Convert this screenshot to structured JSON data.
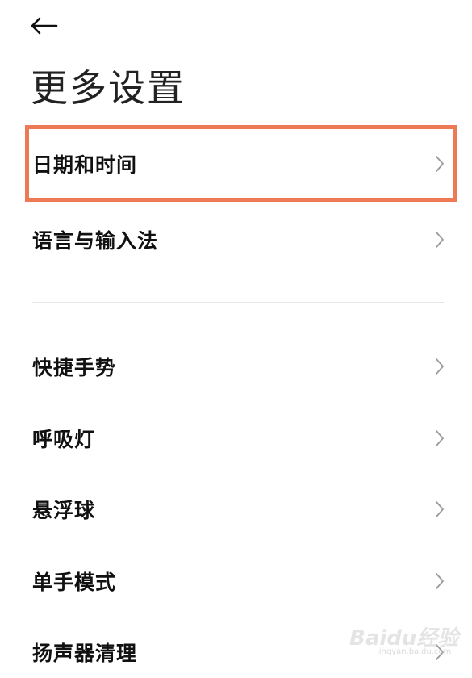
{
  "header": {
    "back_icon": "arrow-left-icon",
    "title": "更多设置"
  },
  "settings": {
    "items": [
      {
        "label": "日期和时间",
        "highlighted": true
      },
      {
        "label": "语言与输入法"
      },
      {
        "label": "快捷手势"
      },
      {
        "label": "呼吸灯"
      },
      {
        "label": "悬浮球"
      },
      {
        "label": "单手模式"
      },
      {
        "label": "扬声器清理"
      }
    ],
    "chevron_icon": "chevron-right-icon"
  },
  "colors": {
    "highlight": "#ed7a54",
    "text": "#111111",
    "chevron": "#9a9a9a",
    "divider": "#e6e6e6",
    "background": "#ffffff"
  },
  "watermark": {
    "main": "Baidu经验",
    "sub": "jingyan.baidu.com"
  }
}
